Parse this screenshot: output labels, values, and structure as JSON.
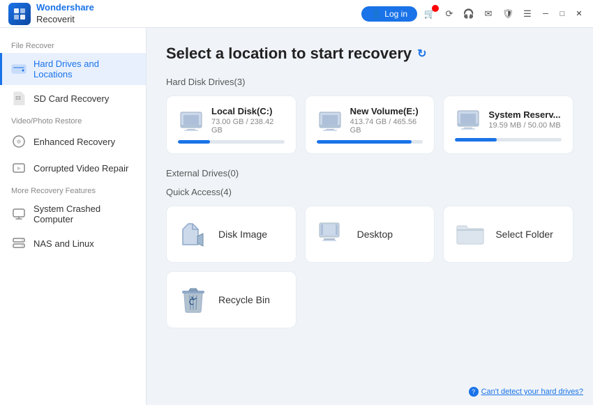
{
  "titlebar": {
    "brand": "Wondershare",
    "product": "Recoverit",
    "login_label": "Log in"
  },
  "sidebar": {
    "section_file_recover": "File Recover",
    "section_video_photo": "Video/Photo Restore",
    "section_more": "More Recovery Features",
    "items": [
      {
        "id": "hard-drives",
        "label": "Hard Drives and Locations",
        "active": true
      },
      {
        "id": "sd-card",
        "label": "SD Card Recovery",
        "active": false
      },
      {
        "id": "enhanced-recovery",
        "label": "Enhanced Recovery",
        "active": false
      },
      {
        "id": "corrupted-video",
        "label": "Corrupted Video Repair",
        "active": false
      },
      {
        "id": "system-crashed",
        "label": "System Crashed Computer",
        "active": false
      },
      {
        "id": "nas-linux",
        "label": "NAS and Linux",
        "active": false
      }
    ]
  },
  "content": {
    "page_title": "Select a location to start recovery",
    "hard_disk_section": "Hard Disk Drives(3)",
    "external_drives_section": "External Drives(0)",
    "quick_access_section": "Quick Access(4)",
    "drives": [
      {
        "name": "Local Disk(C:)",
        "used": "73.00 GB",
        "total": "238.42 GB",
        "fill_pct": 30
      },
      {
        "name": "New Volume(E:)",
        "used": "413.74 GB",
        "total": "465.56 GB",
        "fill_pct": 89
      },
      {
        "name": "System Reserv...",
        "used": "19.59 MB",
        "total": "50.00 MB",
        "fill_pct": 39
      }
    ],
    "quick_access": [
      {
        "id": "disk-image",
        "label": "Disk Image"
      },
      {
        "id": "desktop",
        "label": "Desktop"
      },
      {
        "id": "select-folder",
        "label": "Select Folder"
      },
      {
        "id": "recycle-bin",
        "label": "Recycle Bin"
      }
    ],
    "bottom_link": "Can't detect your hard drives?"
  },
  "icons": {
    "refresh": "↻",
    "login_person": "👤",
    "cart": "🛒",
    "question": "?"
  }
}
